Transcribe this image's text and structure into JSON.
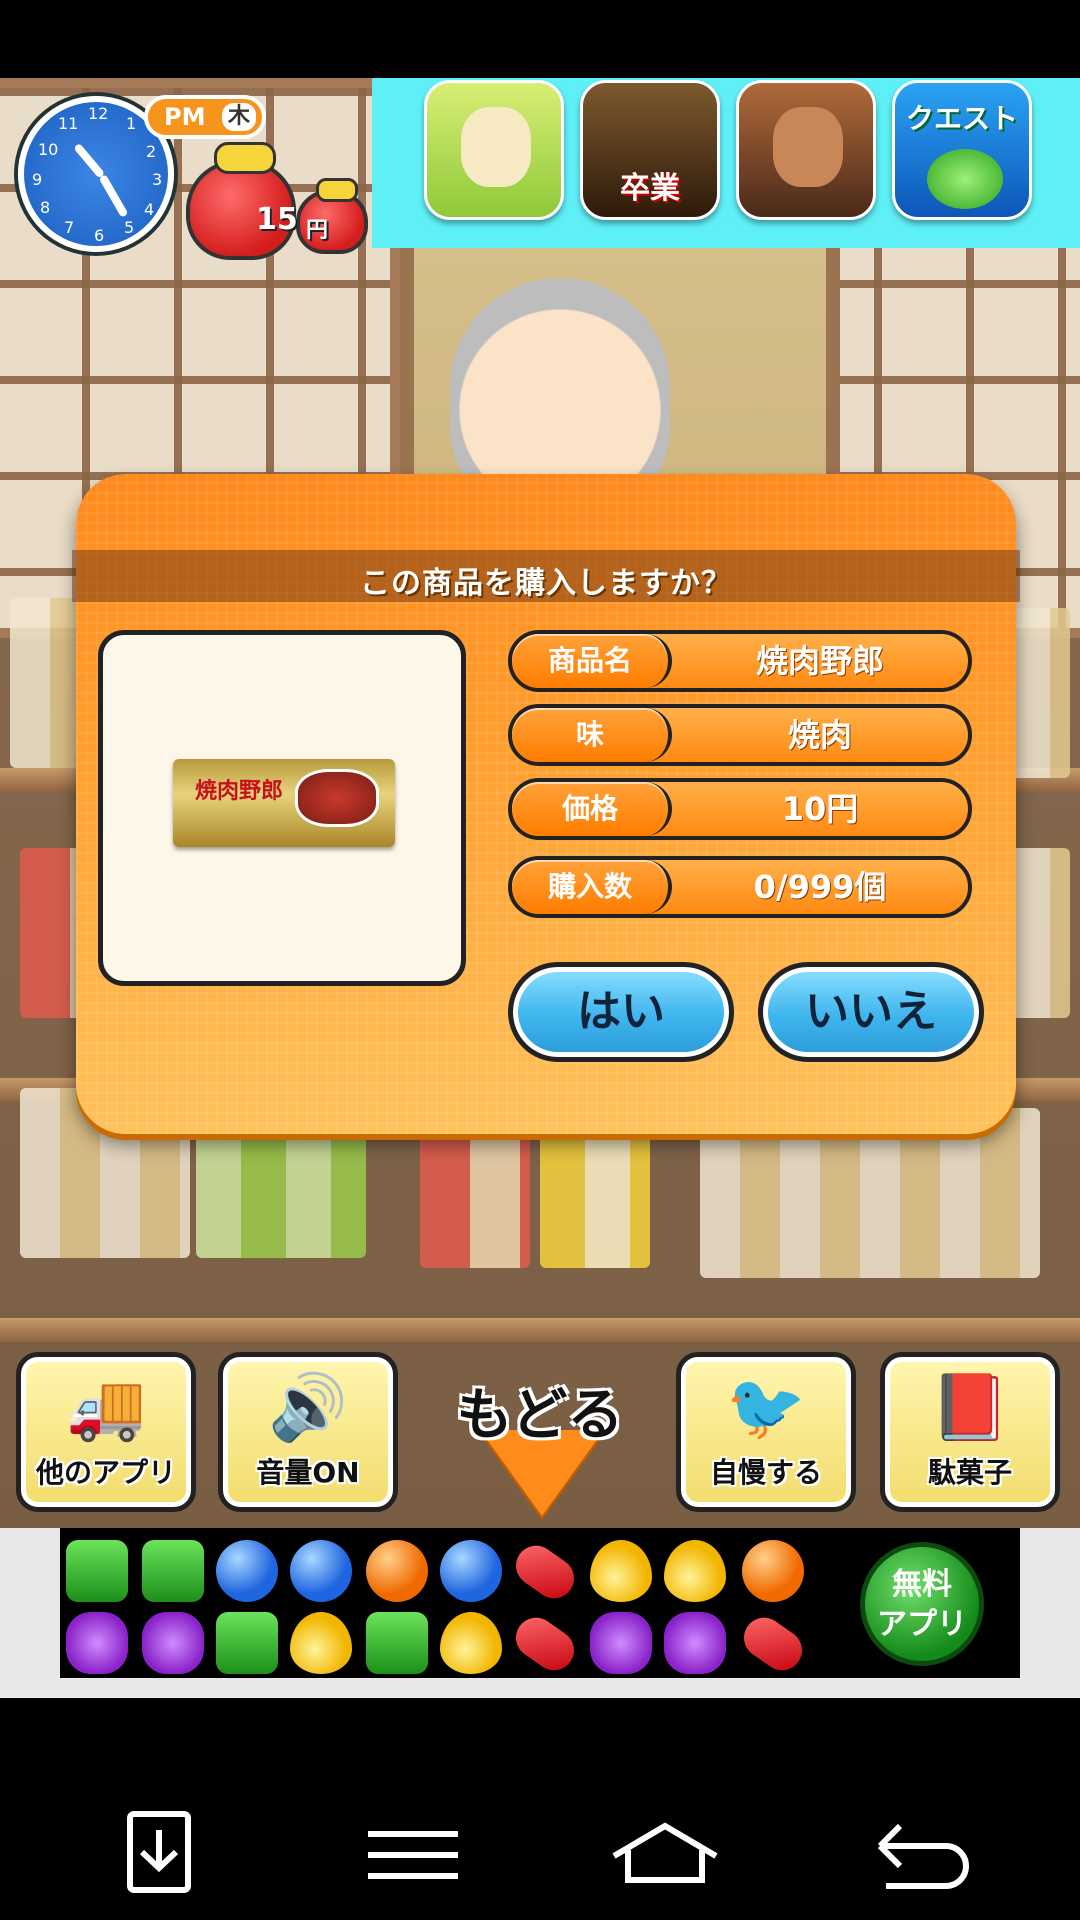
{
  "hud": {
    "ampm": "PM",
    "weekday": "木",
    "money": "15",
    "money_unit": "円",
    "clock_numbers": [
      "12",
      "1",
      "2",
      "3",
      "4",
      "5",
      "6",
      "7",
      "8",
      "9",
      "10",
      "11"
    ]
  },
  "ad_top": {
    "apps": [
      {
        "icon": "giraffe-app-icon"
      },
      {
        "icon": "graduation-app-icon",
        "text": "卒業"
      },
      {
        "icon": "warrior-app-icon"
      },
      {
        "icon": "puyo-quest-app-icon",
        "text": "クエスト"
      }
    ]
  },
  "dialog": {
    "title": "この商品を購入しますか？",
    "product_image_label": "焼肉野郎",
    "rows": [
      {
        "key": "商品名",
        "value": "焼肉野郎"
      },
      {
        "key": "味",
        "value": "焼肉"
      },
      {
        "key": "価格",
        "value": "10円"
      },
      {
        "key": "購入数",
        "value": "0/999個"
      }
    ],
    "yes_label": "はい",
    "no_label": "いいえ"
  },
  "menu": {
    "other_apps": "他のアプリ",
    "sound": "音量ON",
    "back": "もどる",
    "boast": "自慢する",
    "dagashi": "駄菓子"
  },
  "ad_bottom": {
    "free_app": "無料\nアプリ"
  },
  "colors": {
    "dialog_orange": "#ff8a1e",
    "button_blue": "#3fb5ee",
    "banner_cyan": "#5ff0f7"
  }
}
